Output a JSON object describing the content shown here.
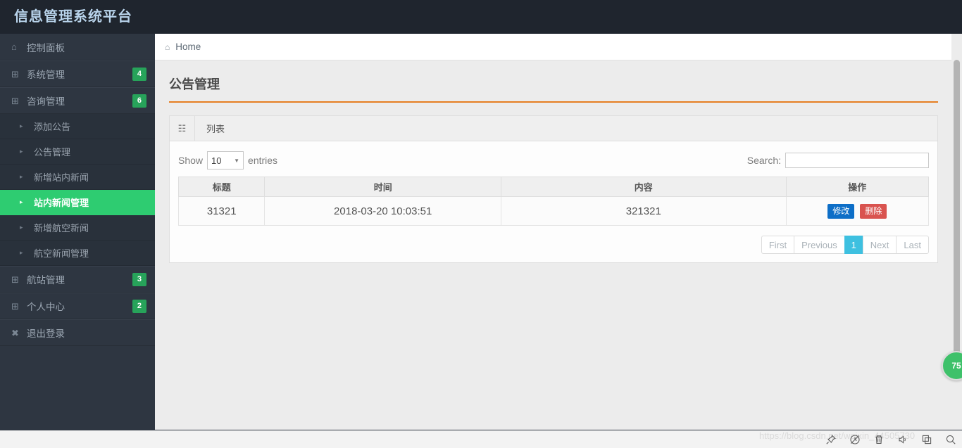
{
  "header": {
    "brand": "信息管理系统平台"
  },
  "sidebar": {
    "items": [
      {
        "icon": "home-icon",
        "glyph": "⌂",
        "label": "控制面板",
        "badge": ""
      },
      {
        "icon": "grid-icon",
        "glyph": "⊞",
        "label": "系统管理",
        "badge": "4"
      },
      {
        "icon": "grid-icon",
        "glyph": "⊞",
        "label": "咨询管理",
        "badge": "6"
      }
    ],
    "subitems": [
      {
        "label": "添加公告",
        "active": false
      },
      {
        "label": "公告管理",
        "active": false
      },
      {
        "label": "新增站内新闻",
        "active": false
      },
      {
        "label": "站内新闻管理",
        "active": true
      },
      {
        "label": "新增航空新闻",
        "active": false
      },
      {
        "label": "航空新闻管理",
        "active": false
      }
    ],
    "items_bottom": [
      {
        "icon": "grid-icon",
        "glyph": "⊞",
        "label": "航站管理",
        "badge": "3"
      },
      {
        "icon": "grid-icon",
        "glyph": "⊞",
        "label": "个人中心",
        "badge": "2"
      },
      {
        "icon": "close-icon",
        "glyph": "✖",
        "label": "退出登录",
        "badge": ""
      }
    ],
    "caret_glyph": "▸",
    "badge_color": "#27a35a",
    "active_color": "#2ecc71"
  },
  "breadcrumb": {
    "home_glyph": "⌂",
    "label": "Home"
  },
  "page": {
    "title": "公告管理",
    "accent_color": "#e67e22"
  },
  "panel": {
    "tab_icon": "grid-icon",
    "tab_icon_glyph": "☷",
    "tab_label": "列表"
  },
  "datatable": {
    "show_label": "Show",
    "length_value": "10",
    "entries_label": "entries",
    "search_label": "Search:",
    "search_value": "",
    "search_placeholder": "",
    "columns": [
      "标题",
      "时间",
      "内容",
      "操作"
    ],
    "rows": [
      {
        "title": "31321",
        "time": "2018-03-20 10:03:51",
        "content": "321321",
        "edit_label": "修改",
        "delete_label": "删除"
      }
    ],
    "pagination": {
      "first": "First",
      "previous": "Previous",
      "current": "1",
      "next": "Next",
      "last": "Last",
      "active_color": "#3ec0e0"
    }
  },
  "float_badge": {
    "value": "75"
  },
  "bottom": {
    "watermark": "https://blog.csdn.net/weixin_44505730",
    "icons": [
      "pin-icon",
      "history-icon",
      "trash-icon",
      "speaker-icon",
      "copy-icon",
      "search-icon"
    ]
  }
}
